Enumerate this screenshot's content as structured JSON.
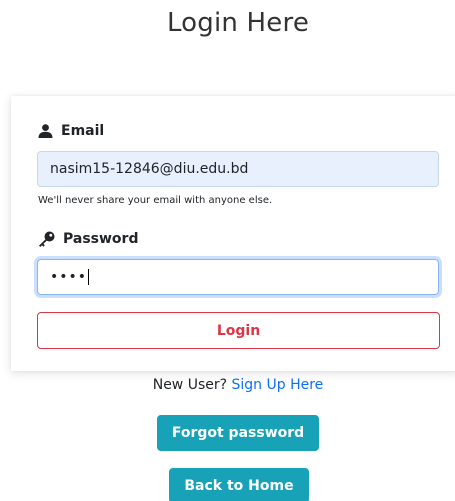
{
  "page": {
    "title": "Login Here"
  },
  "form": {
    "email_label": "Email",
    "email_value": "nasim15-12846@diu.edu.bd",
    "email_help": "We'll never share your email with anyone else.",
    "password_label": "Password",
    "password_value": "••••",
    "login_label": "Login"
  },
  "footer": {
    "new_user_text": "New User?",
    "signup_link": "Sign Up Here",
    "forgot_label": "Forgot password",
    "home_label": "Back to Home"
  },
  "icons": {
    "email": "user-icon",
    "password": "key-icon"
  },
  "colors": {
    "danger": "#dc3545",
    "info": "#17a2b8",
    "link": "#0d6efd",
    "autofill": "#e8f0fe"
  }
}
